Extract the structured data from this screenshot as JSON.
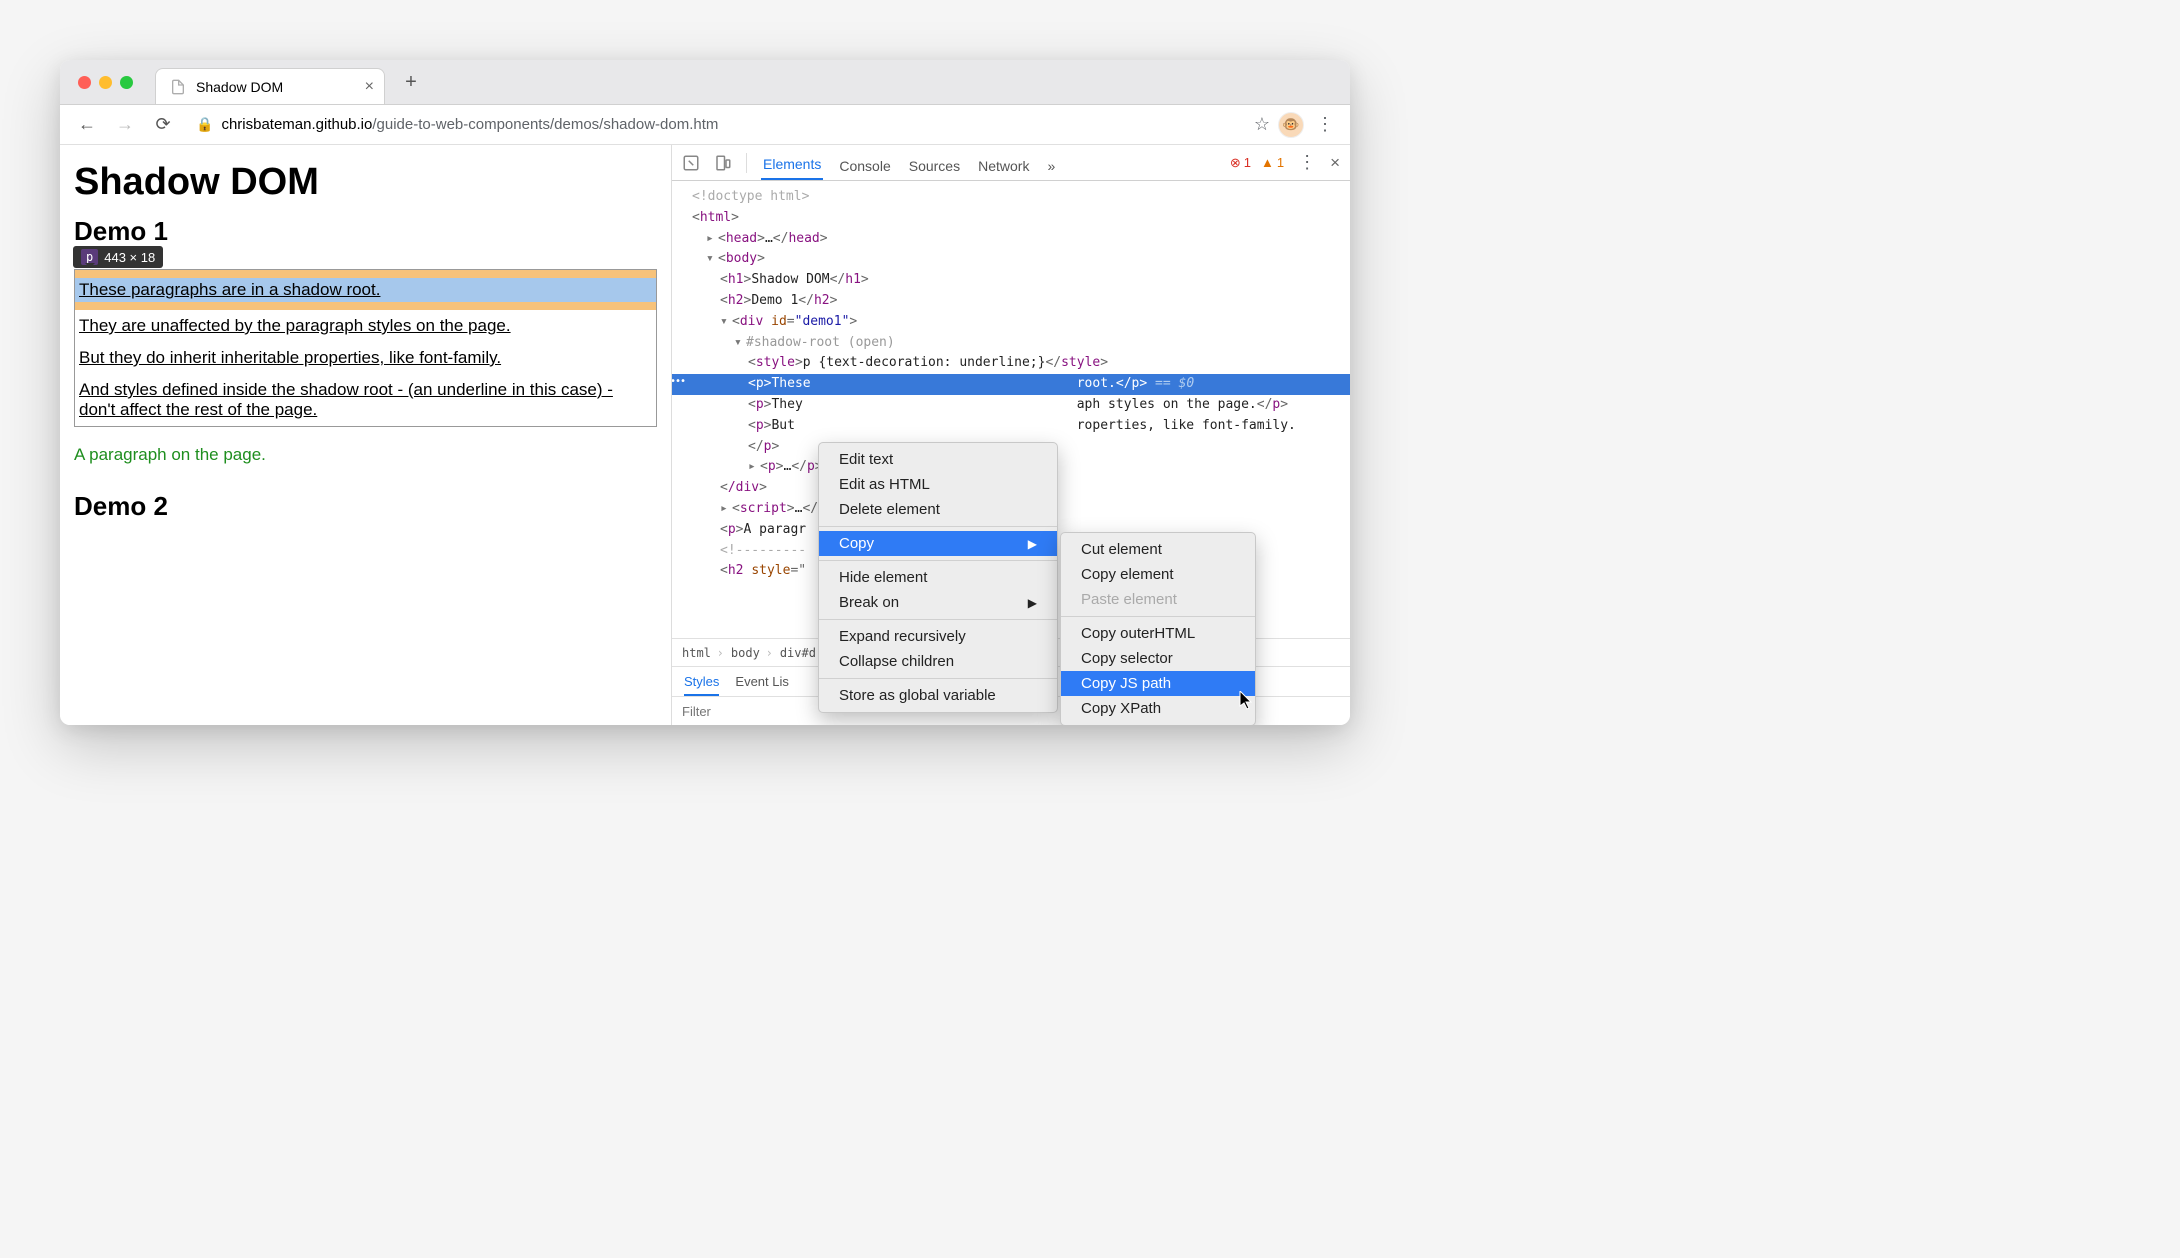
{
  "browser": {
    "tab_title": "Shadow DOM",
    "url_prefix": "chrisbateman.github.io",
    "url_path": "/guide-to-web-components/demos/shadow-dom.htm",
    "avatar_emoji": "🐵"
  },
  "page": {
    "h1": "Shadow DOM",
    "h2a": "Demo 1",
    "h2b": "Demo 2",
    "tooltip_tag": "p",
    "tooltip_dims": "443 × 18",
    "p1": "These paragraphs are in a shadow root.",
    "p2": "They are unaffected by the paragraph styles on the page.",
    "p3": "But they do inherit inheritable properties, like font-family.",
    "p4": "And styles defined inside the shadow root - (an underline in this case) - don't affect the rest of the page.",
    "outside_para": "A paragraph on the page."
  },
  "devtools": {
    "tabs": {
      "elements": "Elements",
      "console": "Console",
      "sources": "Sources",
      "network": "Network"
    },
    "error_count": "1",
    "warn_count": "1",
    "tree": {
      "l1": "<!doctype html>",
      "l2a": "<",
      "l2b": "html",
      "l2c": ">",
      "l3_head": "head",
      "l4_body": "body",
      "l5_h1": "h1",
      "l5_h1txt": "Shadow DOM",
      "l6_h2": "h2",
      "l6_h2txt": "Demo 1",
      "l7_div": "div",
      "l7_id": "id",
      "l7_val": "\"demo1\"",
      "l8_shadow": "#shadow-root (open)",
      "l9_style": "style",
      "l9_css": "p {text-decoration: underline;}",
      "l10_p": "p",
      "l10_txt_a": "These",
      "l10_txt_b": "root.",
      "l10_suffix": " == $0",
      "l11_txt_a": "They",
      "l11_txt_b": "aph styles on the page.",
      "l12_txt_a": "But ",
      "l12_txt_b": "roperties, like font-family.",
      "l13_p_open": "p",
      "l13_close": "/p",
      "l14_p": "p",
      "l15_div_close": "/div",
      "l16_script": "script",
      "l17_p": "p",
      "l17_txt": "A paragr",
      "l18_comment": "<!---------",
      "l19_h2": "h2",
      "l19_style_attr": "style"
    },
    "breadcrumb": {
      "a": "html",
      "b": "body",
      "c": "div#d"
    },
    "styles_tab": "Styles",
    "event_tab": "Event Lis",
    "filter_placeholder": "Filter"
  },
  "ctx1": {
    "edit_text": "Edit text",
    "edit_html": "Edit as HTML",
    "delete": "Delete element",
    "copy": "Copy",
    "hide": "Hide element",
    "break": "Break on",
    "expand": "Expand recursively",
    "collapse": "Collapse children",
    "store": "Store as global variable"
  },
  "ctx2": {
    "cut": "Cut element",
    "copy_el": "Copy element",
    "paste": "Paste element",
    "outer": "Copy outerHTML",
    "selector": "Copy selector",
    "jspath": "Copy JS path",
    "xpath": "Copy XPath"
  }
}
